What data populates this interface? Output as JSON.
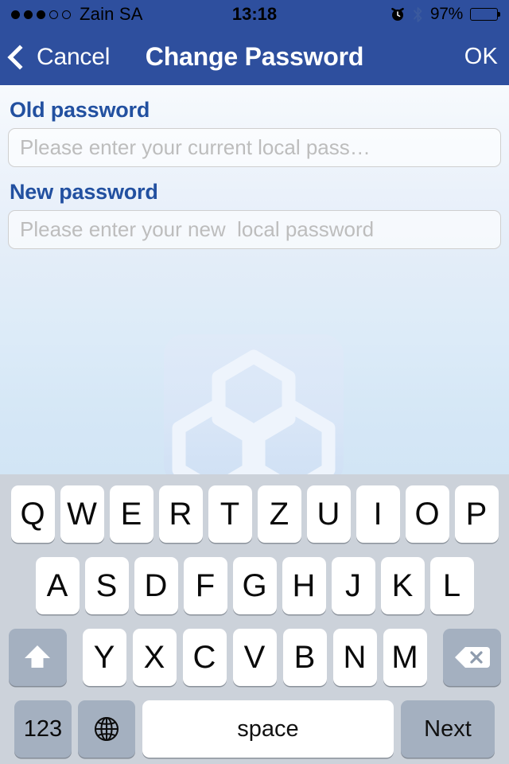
{
  "status_bar": {
    "signal_dots_filled": 3,
    "signal_dots_total": 5,
    "carrier": "Zain SA",
    "time": "13:18",
    "battery_percent": "97%",
    "icons": [
      "alarm-clock-icon",
      "bluetooth-icon",
      "battery-icon"
    ],
    "background_color": "#2e4f9e"
  },
  "nav_bar": {
    "back_label": "Cancel",
    "title": "Change Password",
    "action_label": "OK",
    "background_color": "#2e4f9e",
    "text_color": "#ffffff"
  },
  "form": {
    "label_color": "#2250a0",
    "fields": [
      {
        "label": "Old password",
        "placeholder": "Please enter your current local pass…",
        "value": ""
      },
      {
        "label": "New password",
        "placeholder": "Please enter your new  local password",
        "value": ""
      }
    ]
  },
  "watermark": {
    "name": "app-logo-watermark",
    "description": "faint rounded-square logo with interlocking hexagons"
  },
  "keyboard": {
    "layout": "QWERTZ",
    "background_color": "#ccd2da",
    "key_color": "#ffffff",
    "modifier_key_color": "#a4b0c0",
    "rows": [
      [
        "Q",
        "W",
        "E",
        "R",
        "T",
        "Z",
        "U",
        "I",
        "O",
        "P"
      ],
      [
        "A",
        "S",
        "D",
        "F",
        "G",
        "H",
        "J",
        "K",
        "L"
      ],
      [
        "Y",
        "X",
        "C",
        "V",
        "B",
        "N",
        "M"
      ]
    ],
    "shift_key": "shift-icon",
    "backspace_key": "backspace-icon",
    "numeric_key": "123",
    "globe_key": "globe-icon",
    "space_key": "space",
    "return_key": "Next"
  }
}
